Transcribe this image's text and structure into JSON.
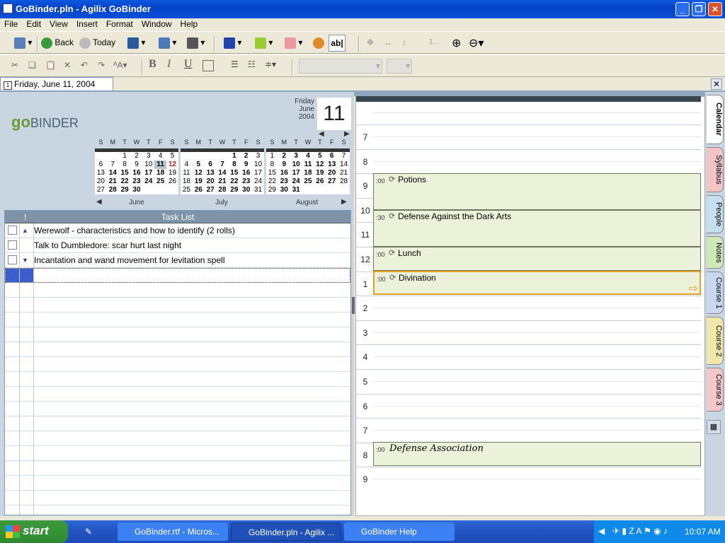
{
  "window": {
    "title": "GoBinder.pln - Agilix GoBinder"
  },
  "menu": [
    "File",
    "Edit",
    "View",
    "Insert",
    "Format",
    "Window",
    "Help"
  ],
  "toolbar": {
    "back_label": "Back",
    "today_label": "Today",
    "font_placeholder": "1..."
  },
  "date_tab": {
    "label": "Friday, June 11, 2004"
  },
  "header": {
    "dayname": "Friday",
    "month": "June",
    "year": "2004",
    "day": "11"
  },
  "logo": {
    "text1": "go",
    "text2": "binder"
  },
  "weekdays": [
    "S",
    "M",
    "T",
    "W",
    "T",
    "F",
    "S"
  ],
  "mini_cals": [
    {
      "name": "June",
      "days": [
        "",
        "",
        "1",
        "2",
        "3",
        "4",
        "5",
        "6",
        "7",
        "8",
        "9",
        "10",
        "11",
        "12",
        "13",
        "14",
        "15",
        "16",
        "17",
        "18",
        "19",
        "20",
        "21",
        "22",
        "23",
        "24",
        "25",
        "26",
        "27",
        "28",
        "29",
        "30"
      ]
    },
    {
      "name": "July",
      "days": [
        "",
        "",
        "",
        "",
        "1",
        "2",
        "3",
        "4",
        "5",
        "6",
        "7",
        "8",
        "9",
        "10",
        "11",
        "12",
        "13",
        "14",
        "15",
        "16",
        "17",
        "18",
        "19",
        "20",
        "21",
        "22",
        "23",
        "24",
        "25",
        "26",
        "27",
        "28",
        "29",
        "30",
        "31"
      ]
    },
    {
      "name": "August",
      "days": [
        "1",
        "2",
        "3",
        "4",
        "5",
        "6",
        "7",
        "8",
        "9",
        "10",
        "11",
        "12",
        "13",
        "14",
        "15",
        "16",
        "17",
        "18",
        "19",
        "20",
        "21",
        "22",
        "23",
        "24",
        "25",
        "26",
        "27",
        "28",
        "29",
        "30",
        "31"
      ]
    }
  ],
  "tasklist": {
    "title": "Task List",
    "priority_col": "!",
    "tasks": [
      {
        "priority": "high",
        "text": "Werewolf - characteristics and how to identify (2 rolls)"
      },
      {
        "priority": "",
        "text": "Talk to Dumbledore: scar hurt last night"
      },
      {
        "priority": "low",
        "text": "Incantation and wand movement for levitation spell"
      }
    ]
  },
  "hours": [
    "7",
    "8",
    "9",
    "10",
    "11",
    "12",
    "1",
    "2",
    "3",
    "4",
    "5",
    "6",
    "7",
    "8",
    "9"
  ],
  "appointments": [
    {
      "time": ":00",
      "title": "Potions"
    },
    {
      "time": ":30",
      "title": "Defense Against the Dark Arts"
    },
    {
      "time": ":00",
      "title": "Lunch"
    },
    {
      "time": ":00",
      "title": "Divination"
    },
    {
      "time": ":00",
      "title": "Defense Association"
    }
  ],
  "side_tabs": [
    {
      "label": "Calendar",
      "color": "#e8eef4"
    },
    {
      "label": "Syllabus",
      "color": "#f2c4c4"
    },
    {
      "label": "People",
      "color": "#c6dff0"
    },
    {
      "label": "Notes",
      "color": "#cfe8b8"
    },
    {
      "label": "Course 1",
      "color": "#c8d8f0"
    },
    {
      "label": "Course 2",
      "color": "#f0e8a8"
    },
    {
      "label": "Course 3",
      "color": "#f4c8c8"
    }
  ],
  "taskbar": {
    "start": "start",
    "buttons": [
      "GoBinder.rtf - Micros...",
      "GoBinder.pln - Agilix ...",
      "GoBinder Help"
    ],
    "clock": "10:07 AM"
  }
}
